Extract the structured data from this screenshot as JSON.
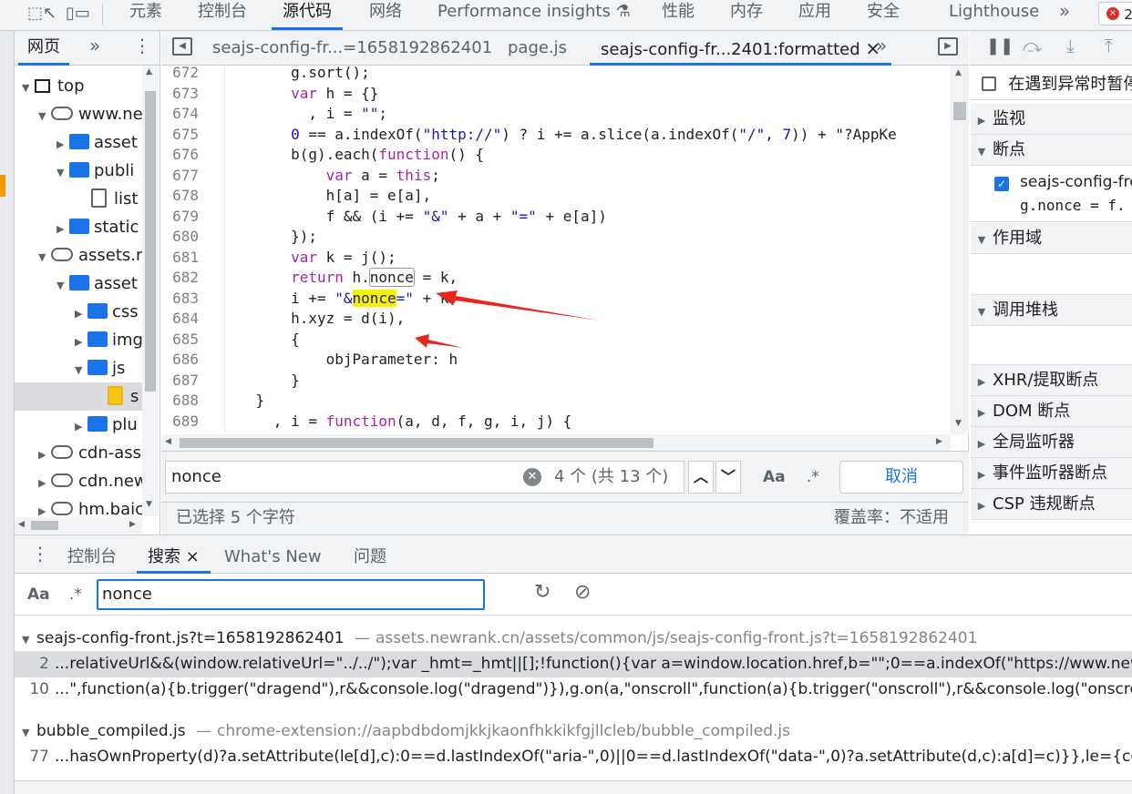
{
  "toolbar": {
    "tabs": [
      "元素",
      "控制台",
      "源代码",
      "网络",
      "Performance insights",
      "性能",
      "内存",
      "应用",
      "安全",
      "Lighthouse"
    ],
    "more": "»",
    "error_count": "2"
  },
  "navigator": {
    "tab": "网页",
    "more": "»",
    "menu": "⋮",
    "tree": [
      "top",
      "www.ne",
      "asset",
      "publi",
      "list",
      "static",
      "assets.r",
      "asset",
      "css",
      "img",
      "js",
      "s",
      "plu",
      "cdn-ass",
      "cdn.new",
      "hm.baic"
    ]
  },
  "editor": {
    "tabs": [
      "seajs-config-fr...=1658192862401",
      "page.js",
      "seajs-config-fr...2401:formatted"
    ],
    "close": "×",
    "more": "»",
    "lines": [
      {
        "n": "672",
        "t": "        g.sort();"
      },
      {
        "n": "673",
        "t": "        var h = {}"
      },
      {
        "n": "674",
        "t": "          , i = \"\";"
      },
      {
        "n": "675",
        "t": "        0 == a.indexOf(\"http://\") ? i += a.slice(a.indexOf(\"/\", 7)) + \"?AppKe"
      },
      {
        "n": "676",
        "t": "        b(g).each(function() {"
      },
      {
        "n": "677",
        "t": "            var a = this;"
      },
      {
        "n": "678",
        "t": "            h[a] = e[a],"
      },
      {
        "n": "679",
        "t": "            f && (i += \"&\" + a + \"=\" + e[a])"
      },
      {
        "n": "680",
        "t": "        });"
      },
      {
        "n": "681",
        "t": "        var k = j();"
      },
      {
        "n": "682",
        "t": "        return h.nonce = k,"
      },
      {
        "n": "683",
        "t": "        i += \"&nonce=\" + k,"
      },
      {
        "n": "684",
        "t": "        h.xyz = d(i),"
      },
      {
        "n": "685",
        "t": "        {"
      },
      {
        "n": "686",
        "t": "            objParameter: h"
      },
      {
        "n": "687",
        "t": "        }"
      },
      {
        "n": "688",
        "t": "    }"
      },
      {
        "n": "689",
        "t": "      , i = function(a, d, f, g, i, j) {"
      }
    ]
  },
  "find": {
    "query": "nonce",
    "count": "4 个 (共 13 个)",
    "case": "Aa",
    "regex": ".*",
    "cancel": "取消"
  },
  "status": {
    "selection": "已选择 5 个字符",
    "coverage": "覆盖率：不适用"
  },
  "debugger": {
    "pause_exceptions": "在遇到异常时暂停",
    "sections": [
      "监视",
      "断点",
      "作用域",
      "调用堆栈",
      "XHR/提取断点",
      "DOM 断点",
      "全局监听器",
      "事件监听器断点",
      "CSP 违规断点"
    ],
    "breakpoint_file": "seajs-config-fro",
    "breakpoint_code": "g.nonce = f."
  },
  "drawer": {
    "menu": "⋮",
    "tabs": [
      "控制台",
      "搜索",
      "What's New",
      "问题"
    ],
    "close": "×",
    "case": "Aa",
    "regex": ".*",
    "query": "nonce"
  },
  "results": [
    {
      "file": "seajs-config-front.js?t=1658192862401",
      "sep": "—",
      "url": "assets.newrank.cn/assets/common/js/seajs-config-front.js?t=1658192862401",
      "matches": [
        {
          "n": "2",
          "t": "...relativeUrl&&(window.relativeUrl=\"../../\");var _hmt=_hmt||[];!function(){var a=window.location.href,b=\"\";0==a.indexOf(\"https://www.newrank.c"
        },
        {
          "n": "10",
          "t": "...\",function(a){b.trigger(\"dragend\"),r&&console.log(\"dragend\")}),g.on(a,\"onscroll\",function(a){b.trigger(\"onscroll\"),r&&console.log(\"onscroll\")}),"
        }
      ]
    },
    {
      "file": "bubble_compiled.js",
      "sep": "—",
      "url": "chrome-extension://aapbdbdomjkkjkaonfhkkikfgjllcleb/bubble_compiled.js",
      "matches": [
        {
          "n": "77",
          "t": "...hasOwnProperty(d)?a.setAttribute(le[d],c):0==d.lastIndexOf(\"aria-\",0)||0==d.lastIndexOf(\"data-\",0)?a.setAttribute(d,c):a[d]=c)}},le={cellpaddin"
        }
      ]
    }
  ],
  "colors": {
    "accent": "#1a73e8",
    "arrow": "#e8251f",
    "highlight": "#f4f400"
  }
}
